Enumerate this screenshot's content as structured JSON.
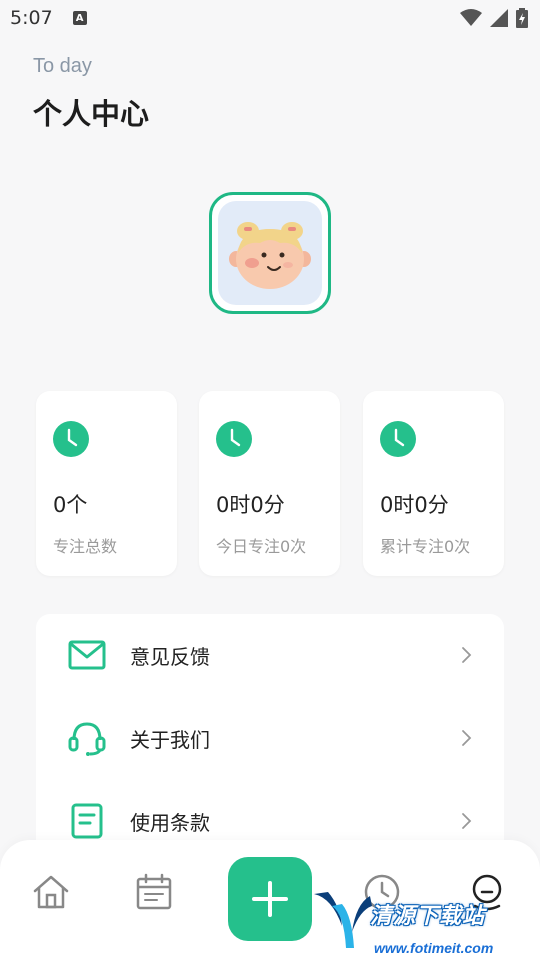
{
  "status_bar": {
    "time": "5:07",
    "indicator": "A"
  },
  "header": {
    "subtitle": "To day",
    "title": "个人中心"
  },
  "colors": {
    "accent": "#25c08c",
    "avatar_border": "#1fb885",
    "avatar_bg": "#e2ebf8"
  },
  "stats": [
    {
      "value": "0个",
      "label": "专注总数",
      "icon": "clock-icon"
    },
    {
      "value": "0时0分",
      "label": "今日专注0次",
      "icon": "clock-icon"
    },
    {
      "value": "0时0分",
      "label": "累计专注0次",
      "icon": "clock-icon"
    }
  ],
  "menu": [
    {
      "label": "意见反馈",
      "icon": "mail-icon"
    },
    {
      "label": "关于我们",
      "icon": "headset-icon"
    },
    {
      "label": "使用条款",
      "icon": "document-icon"
    }
  ],
  "bottom_nav": {
    "items": [
      "home-icon",
      "calendar-icon",
      "add-icon",
      "clock-icon",
      "profile-icon"
    ]
  },
  "watermark": {
    "text": "清源下载站",
    "url": "www.fotimeit.com"
  }
}
